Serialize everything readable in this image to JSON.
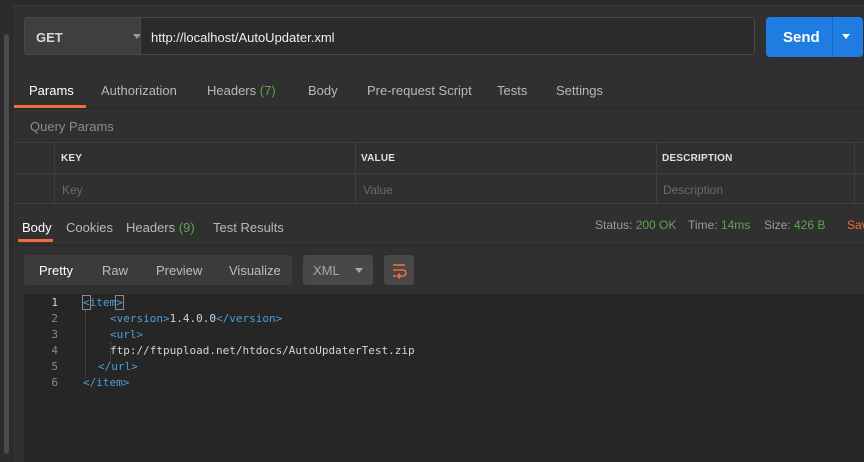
{
  "request": {
    "method": "GET",
    "url": "http://localhost/AutoUpdater.xml",
    "send_label": "Send"
  },
  "request_tabs": [
    {
      "label": "Params"
    },
    {
      "label": "Authorization"
    },
    {
      "label": "Headers",
      "count": "(7)"
    },
    {
      "label": "Body"
    },
    {
      "label": "Pre-request Script"
    },
    {
      "label": "Tests"
    },
    {
      "label": "Settings"
    }
  ],
  "query_params": {
    "title": "Query Params",
    "headers": [
      "KEY",
      "VALUE",
      "DESCRIPTION"
    ],
    "placeholders": [
      "Key",
      "Value",
      "Description"
    ]
  },
  "response": {
    "tabs": [
      {
        "label": "Body"
      },
      {
        "label": "Cookies"
      },
      {
        "label": "Headers",
        "count": "(9)"
      },
      {
        "label": "Test Results"
      }
    ],
    "status_label": "Status:",
    "status_value": "200 OK",
    "time_label": "Time:",
    "time_value": "14ms",
    "size_label": "Size:",
    "size_value": "426 B",
    "save_label": "Sav"
  },
  "format_modes": [
    "Pretty",
    "Raw",
    "Preview",
    "Visualize"
  ],
  "language": "XML",
  "icons": {
    "wrap": "wrap-lines-icon",
    "method_dropdown": "chevron-down-icon",
    "send_dropdown": "chevron-down-icon"
  },
  "colors": {
    "accent": "#f26b3a",
    "send": "#1f7ce0",
    "success": "#59a84b",
    "xml_tag": "#4f9fd4"
  },
  "code": {
    "line_numbers": [
      "1",
      "2",
      "3",
      "4",
      "5",
      "6"
    ],
    "lines": [
      [
        "<",
        "item",
        ">"
      ],
      [
        "<",
        "version",
        ">",
        "1.4.0.0",
        "</",
        "version",
        ">"
      ],
      [
        "<",
        "url",
        ">"
      ],
      [
        "ftp://ftpupload.net/htdocs/AutoUpdaterTest.zip"
      ],
      [
        "</",
        "url",
        ">"
      ],
      [
        "</",
        "item",
        ">"
      ]
    ]
  }
}
